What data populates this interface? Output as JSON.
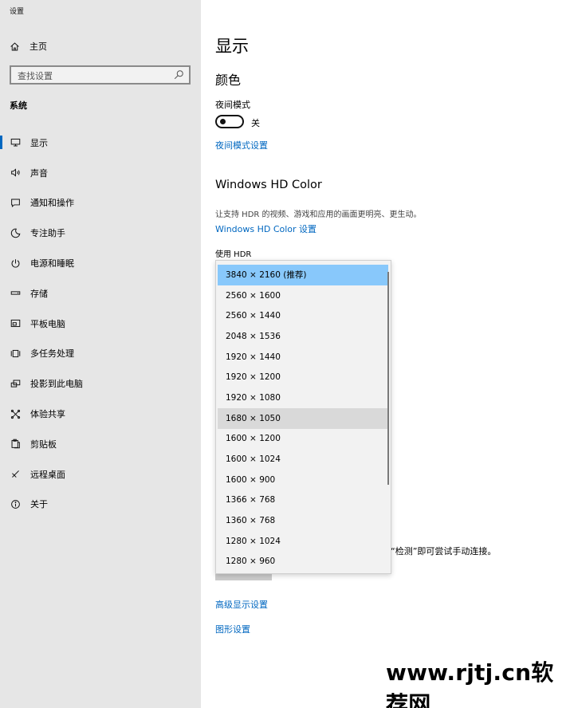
{
  "app": {
    "title": "设置"
  },
  "sidebar": {
    "home_label": "主页",
    "search_placeholder": "查找设置",
    "section_label": "系统",
    "items": [
      {
        "label": "显示",
        "icon": "monitor-icon",
        "active": true
      },
      {
        "label": "声音",
        "icon": "speaker-icon"
      },
      {
        "label": "通知和操作",
        "icon": "notification-icon"
      },
      {
        "label": "专注助手",
        "icon": "moon-icon"
      },
      {
        "label": "电源和睡眠",
        "icon": "power-icon"
      },
      {
        "label": "存储",
        "icon": "storage-icon"
      },
      {
        "label": "平板电脑",
        "icon": "tablet-icon"
      },
      {
        "label": "多任务处理",
        "icon": "multitask-icon"
      },
      {
        "label": "投影到此电脑",
        "icon": "project-icon"
      },
      {
        "label": "体验共享",
        "icon": "share-icon"
      },
      {
        "label": "剪贴板",
        "icon": "clipboard-icon"
      },
      {
        "label": "远程桌面",
        "icon": "remote-icon"
      },
      {
        "label": "关于",
        "icon": "info-icon"
      }
    ]
  },
  "main": {
    "title": "显示",
    "color_heading": "颜色",
    "night_light_label": "夜间模式",
    "night_light_state": "关",
    "night_light_link": "夜间模式设置",
    "hd_color_heading": "Windows HD Color",
    "hd_color_desc": "让支持 HDR 的视频、游戏和应用的画面更明亮、更生动。",
    "hd_color_link": "Windows HD Color 设置",
    "hdr_label": "使用 HDR",
    "partial_text": "“检测”即可尝试手动连接。",
    "advanced_link": "高级显示设置",
    "graphics_link": "图形设置"
  },
  "resolution_dropdown": {
    "options": [
      "3840 × 2160 (推荐)",
      "2560 × 1600",
      "2560 × 1440",
      "2048 × 1536",
      "1920 × 1440",
      "1920 × 1200",
      "1920 × 1080",
      "1680 × 1050",
      "1600 × 1200",
      "1600 × 1024",
      "1600 × 900",
      "1366 × 768",
      "1360 × 768",
      "1280 × 1024",
      "1280 × 960"
    ],
    "selected_index": 0,
    "hover_index": 7
  },
  "watermark": "www.rjtj.cn软荐网",
  "colors": {
    "accent": "#0067c0",
    "selected": "#88c8fb",
    "sidebar_bg": "#e6e6e6"
  }
}
